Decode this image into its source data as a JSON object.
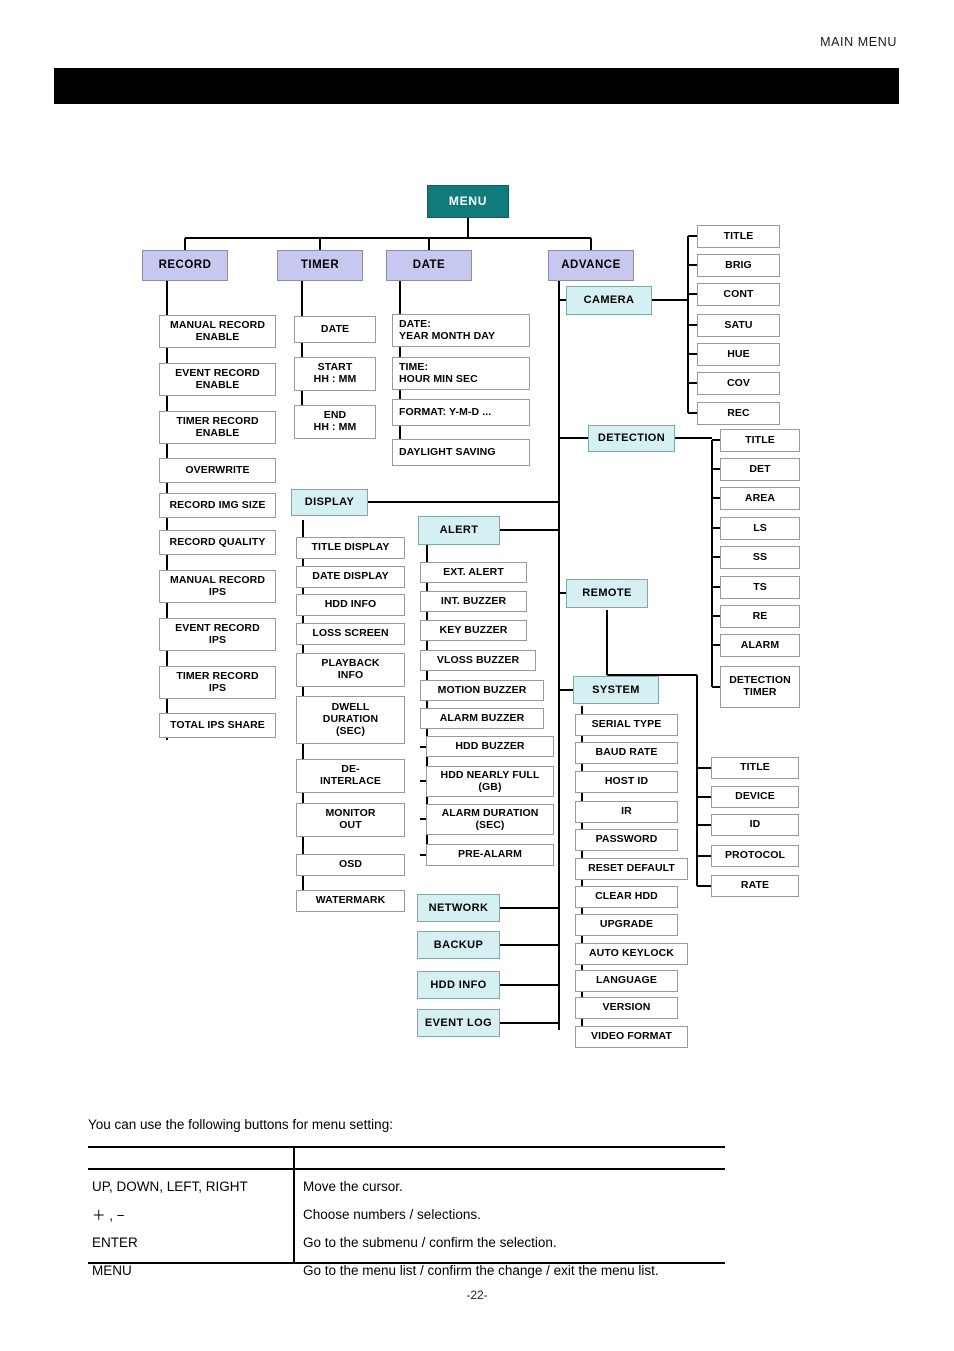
{
  "header": {
    "title": "MAIN  MENU"
  },
  "diagram": {
    "root": {
      "label": "MENU",
      "color": "#0f7b7b"
    },
    "level1_color": "#c7c8f0",
    "level2_color": "#d4f0f2",
    "branches": [
      {
        "label": "RECORD",
        "children": [
          "MANUAL RECORD\nENABLE",
          "EVENT RECORD\nENABLE",
          "TIMER RECORD\nENABLE",
          "OVERWRITE",
          "RECORD IMG SIZE",
          "RECORD QUALITY",
          "MANUAL RECORD\nIPS",
          "EVENT RECORD\nIPS",
          "TIMER RECORD\nIPS",
          "TOTAL IPS SHARE"
        ]
      },
      {
        "label": "TIMER",
        "children": [
          "DATE",
          "START\nHH : MM",
          "END\nHH : MM"
        ]
      },
      {
        "label": "DATE",
        "children": [
          "DATE:\nYEAR MONTH DAY",
          "TIME:\nHOUR MIN SEC",
          "FORMAT: Y-M-D ...",
          "DAYLIGHT  SAVING"
        ]
      },
      {
        "label": "ADVANCE",
        "children": []
      }
    ],
    "advance_submenus": [
      {
        "label": "CAMERA",
        "children": [
          "TITLE",
          "BRIG",
          "CONT",
          "SATU",
          "HUE",
          "COV",
          "REC"
        ]
      },
      {
        "label": "DETECTION",
        "children": [
          "TITLE",
          "DET",
          "AREA",
          "LS",
          "SS",
          "TS",
          "RE",
          "ALARM",
          "DETECTION\nTIMER"
        ]
      },
      {
        "label": "DISPLAY",
        "children": [
          "TITLE DISPLAY",
          "DATE DISPLAY",
          "HDD INFO",
          "LOSS SCREEN",
          "PLAYBACK\nINFO",
          "DWELL\nDURATION\n(SEC)",
          "DE-\nINTERLACE",
          "MONITOR\nOUT",
          "OSD",
          "WATERMARK"
        ]
      },
      {
        "label": "ALERT",
        "children": [
          "EXT. ALERT",
          "INT. BUZZER",
          "KEY BUZZER",
          "VLOSS BUZZER",
          "MOTION BUZZER",
          "ALARM BUZZER",
          "HDD BUZZER",
          "HDD NEARLY FULL\n(GB)",
          "ALARM DURATION\n(SEC)",
          "PRE-ALARM"
        ]
      },
      {
        "label": "REMOTE",
        "children": [
          "TITLE",
          "DEVICE",
          "ID",
          "PROTOCOL",
          "RATE"
        ]
      },
      {
        "label": "SYSTEM",
        "children": [
          "SERIAL TYPE",
          "BAUD RATE",
          "HOST ID",
          "IR",
          "PASSWORD",
          "RESET DEFAULT",
          "CLEAR HDD",
          "UPGRADE",
          "AUTO KEYLOCK",
          "LANGUAGE",
          "VERSION",
          "VIDEO FORMAT"
        ]
      },
      {
        "label": "NETWORK",
        "children": []
      },
      {
        "label": "BACKUP",
        "children": []
      },
      {
        "label": "HDD INFO",
        "children": []
      },
      {
        "label": "EVENT LOG",
        "children": []
      }
    ]
  },
  "footer": {
    "intro": "You can use the following buttons for menu setting:",
    "table": {
      "header": [
        "",
        ""
      ],
      "rows": [
        [
          "UP, DOWN, LEFT, RIGHT",
          "Move the cursor."
        ],
        [
          "＋ ,  −",
          "Choose numbers / selections."
        ],
        [
          "ENTER",
          "Go to the submenu / confirm the selection."
        ],
        [
          "MENU",
          "Go to the menu list / confirm the change / exit the menu list."
        ]
      ]
    },
    "page_number": "-22-"
  }
}
